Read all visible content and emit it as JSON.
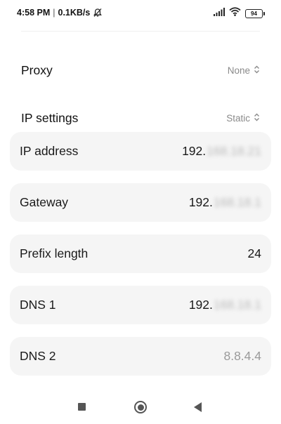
{
  "status_bar": {
    "time": "4:58 PM",
    "separator": "|",
    "speed": "0.1KB/s",
    "battery": "94",
    "icons": [
      "silent-bell-icon",
      "signal-icon",
      "wifi-icon",
      "battery-icon"
    ]
  },
  "proxy": {
    "label": "Proxy",
    "value": "None"
  },
  "ip_settings": {
    "label": "IP settings",
    "value": "Static"
  },
  "fields": {
    "ip_address": {
      "label": "IP address",
      "value_visible": "192.",
      "value_blurred": "168.18.21"
    },
    "gateway": {
      "label": "Gateway",
      "value_visible": "192.",
      "value_blurred": "168.18.1"
    },
    "prefix_length": {
      "label": "Prefix length",
      "value": "24"
    },
    "dns1": {
      "label": "DNS 1",
      "value_visible": "192.",
      "value_blurred": "168.18.1"
    },
    "dns2": {
      "label": "DNS 2",
      "placeholder": "8.8.4.4"
    }
  },
  "nav_bar": {
    "icons": [
      "recents-square-icon",
      "home-circle-icon",
      "back-triangle-icon"
    ]
  },
  "colors": {
    "card_background": "#f5f5f5",
    "secondary_text": "#8a8a8a",
    "placeholder_text": "#9a9a9a"
  }
}
